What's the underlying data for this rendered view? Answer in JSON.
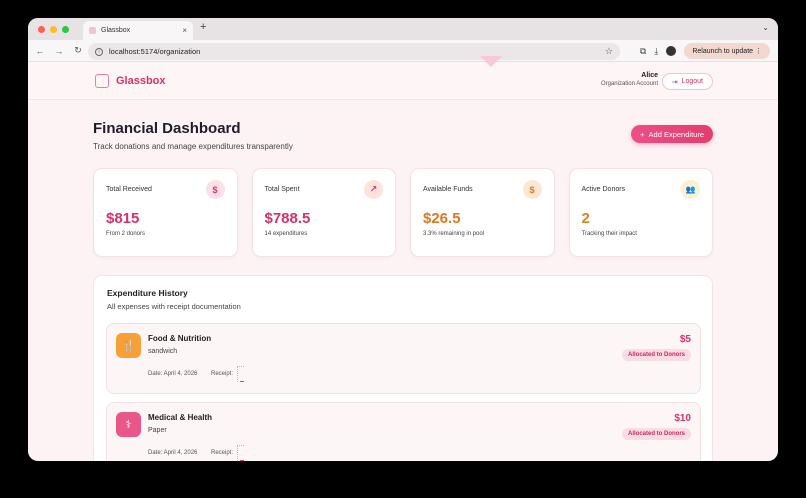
{
  "browser": {
    "tab_title": "Glassbox",
    "new_tab": "+",
    "url": "localhost:5174/organization",
    "relaunch_label": "Relaunch to update",
    "traffic_colors": [
      "#ff5f57",
      "#febc2e",
      "#28c840"
    ]
  },
  "header": {
    "brand": "Glassbox",
    "user_name": "Alice",
    "user_role": "Organization Account",
    "logout_label": "Logout"
  },
  "page": {
    "title": "Financial Dashboard",
    "subtitle": "Track donations and manage expenditures transparently",
    "add_button": "Add Expenditure"
  },
  "cards": [
    {
      "label": "Total Received",
      "value": "$815",
      "note": "From 2 donors",
      "icon": "dollar-icon",
      "glyph": "$",
      "color": "#d9326b",
      "icon_bg": "#fbe0e7"
    },
    {
      "label": "Total Spent",
      "value": "$788.5",
      "note": "14 expenditures",
      "icon": "trending-up-icon",
      "glyph": "↗",
      "color": "#d9326b",
      "icon_bg": "#fde3dc"
    },
    {
      "label": "Available Funds",
      "value": "$26.5",
      "note": "3.3% remaining in pool",
      "icon": "dollar-icon",
      "glyph": "$",
      "color": "#e0781c",
      "icon_bg": "#fde7d3"
    },
    {
      "label": "Active Donors",
      "value": "2",
      "note": "Tracking their impact",
      "icon": "users-icon",
      "glyph": "👥",
      "color": "#d6861a",
      "icon_bg": "#fdf0cf"
    }
  ],
  "history": {
    "title": "Expenditure History",
    "subtitle": "All expenses with receipt documentation",
    "items": [
      {
        "title": "Food & Nutrition",
        "description": "sandwich",
        "date": "Date: April 4, 2026",
        "receipt_label": "Receipt:",
        "amount": "$5",
        "badge": "Allocated to Donors",
        "icon": "utensils-icon",
        "glyph": "🍴",
        "icon_color": "#f6a037"
      },
      {
        "title": "Medical & Health",
        "description": "Paper",
        "date": "Date: April 4, 2026",
        "receipt_label": "Receipt:",
        "amount": "$10",
        "badge": "Allocated to Donors",
        "icon": "stethoscope-icon",
        "glyph": "⚕",
        "icon_color": "#e9578a"
      }
    ]
  }
}
